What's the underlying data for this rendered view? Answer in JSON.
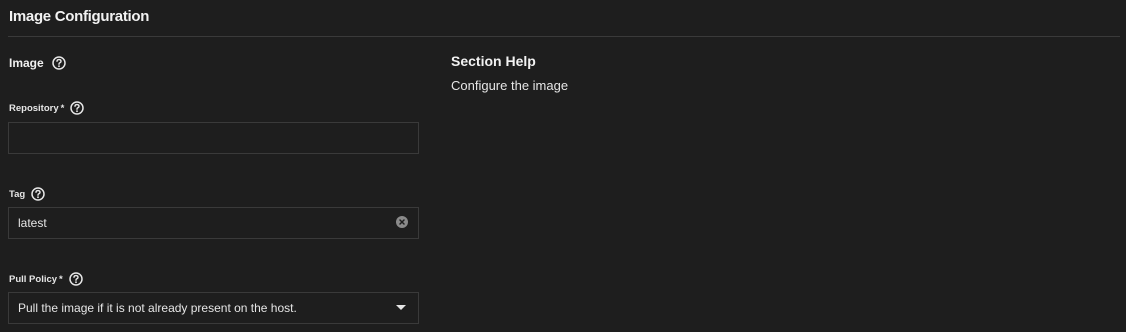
{
  "header": {
    "title": "Image Configuration"
  },
  "image_section": {
    "label": "Image",
    "help_icon": "help-circle-icon"
  },
  "fields": {
    "repository": {
      "label": "Repository",
      "required_marker": "*",
      "value": ""
    },
    "tag": {
      "label": "Tag",
      "value": "latest"
    },
    "pull_policy": {
      "label": "Pull Policy",
      "required_marker": "*",
      "selected": "Pull the image if it is not already present on the host."
    }
  },
  "section_help": {
    "title": "Section Help",
    "text": "Configure the image"
  },
  "colors": {
    "background": "#1e1e1e",
    "border": "#3a3a3a",
    "text": "#e6e6e6"
  }
}
